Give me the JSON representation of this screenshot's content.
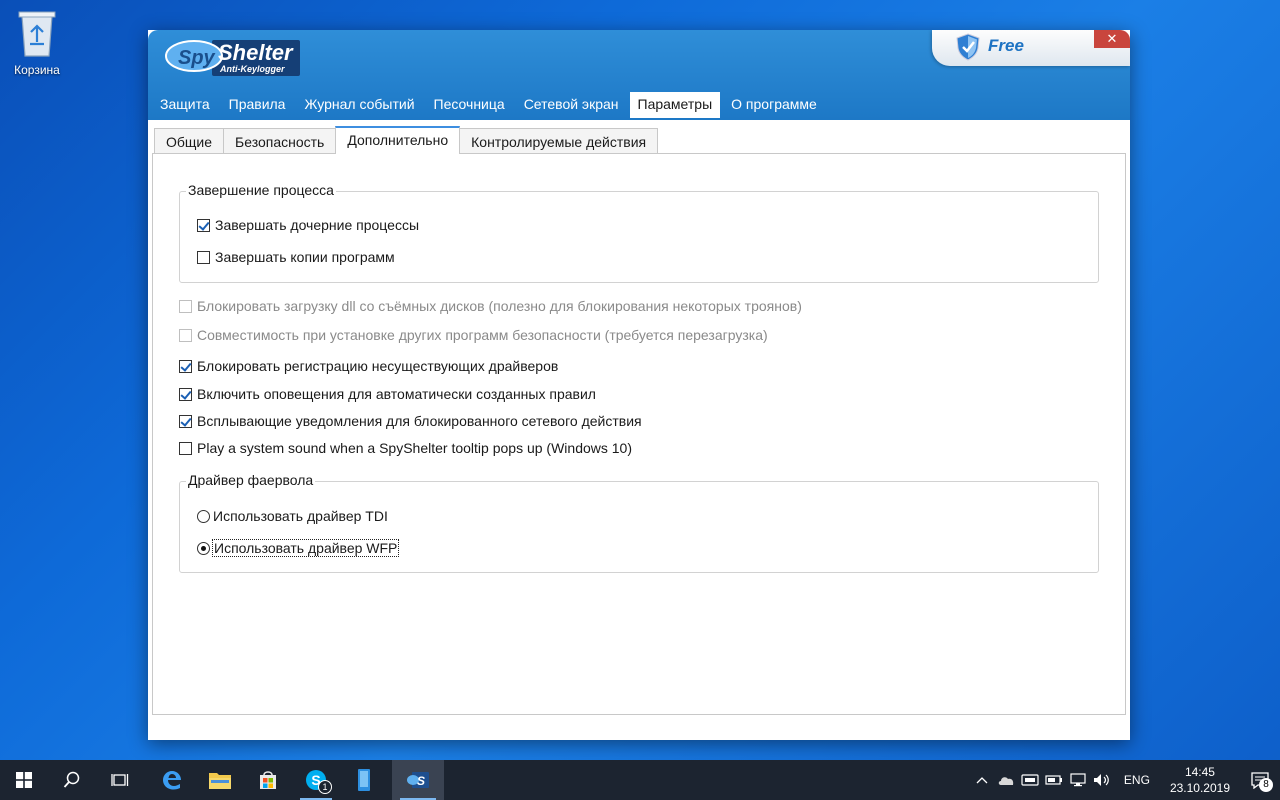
{
  "desktop": {
    "recycle_bin_label": "Корзина"
  },
  "window": {
    "logo_top": "Spy",
    "logo_main": "Shelter",
    "logo_sub": "Anti-Keylogger",
    "badge": "Free",
    "close_glyph": "✕",
    "menu": [
      {
        "label": "Защита",
        "active": false
      },
      {
        "label": "Правила",
        "active": false
      },
      {
        "label": "Журнал событий",
        "active": false
      },
      {
        "label": "Песочница",
        "active": false
      },
      {
        "label": "Сетевой экран",
        "active": false
      },
      {
        "label": "Параметры",
        "active": true
      },
      {
        "label": "О программе",
        "active": false
      }
    ],
    "tabs": [
      {
        "label": "Общие",
        "active": false
      },
      {
        "label": "Безопасность",
        "active": false
      },
      {
        "label": "Дополнительно",
        "active": true
      },
      {
        "label": "Контролируемые действия",
        "active": false
      }
    ]
  },
  "settings": {
    "process_group": {
      "title": "Завершение процесса",
      "options": [
        {
          "label": "Завершать дочерние процессы",
          "checked": true
        },
        {
          "label": "Завершать копии программ",
          "checked": false
        }
      ]
    },
    "options": [
      {
        "label": "Блокировать загрузку dll со съёмных дисков (полезно для блокирования некоторых троянов)",
        "checked": false,
        "disabled": true
      },
      {
        "label": "Совместимость при установке других программ безопасности (требуется перезагрузка)",
        "checked": false,
        "disabled": true
      },
      {
        "label": "Блокировать регистрацию несуществующих драйверов",
        "checked": true,
        "disabled": false
      },
      {
        "label": "Включить оповещения для автоматически созданных правил",
        "checked": true,
        "disabled": false
      },
      {
        "label": "Всплывающие уведомления для блокированного сетевого действия",
        "checked": true,
        "disabled": false
      },
      {
        "label": "Play a system sound when a SpyShelter tooltip pops up (Windows 10)",
        "checked": false,
        "disabled": false
      }
    ],
    "firewall_group": {
      "title": "Драйвер фаервола",
      "options": [
        {
          "label": "Использовать драйвер TDI",
          "selected": false
        },
        {
          "label": "Использовать драйвер WFP",
          "selected": true
        }
      ]
    }
  },
  "taskbar": {
    "skype_badge": "1",
    "language": "ENG",
    "time": "14:45",
    "date": "23.10.2019",
    "notification_count": "8"
  },
  "colors": {
    "header_blue": "#1d78c6",
    "accent": "#3d8ee0",
    "taskbar": "#1c2430"
  }
}
